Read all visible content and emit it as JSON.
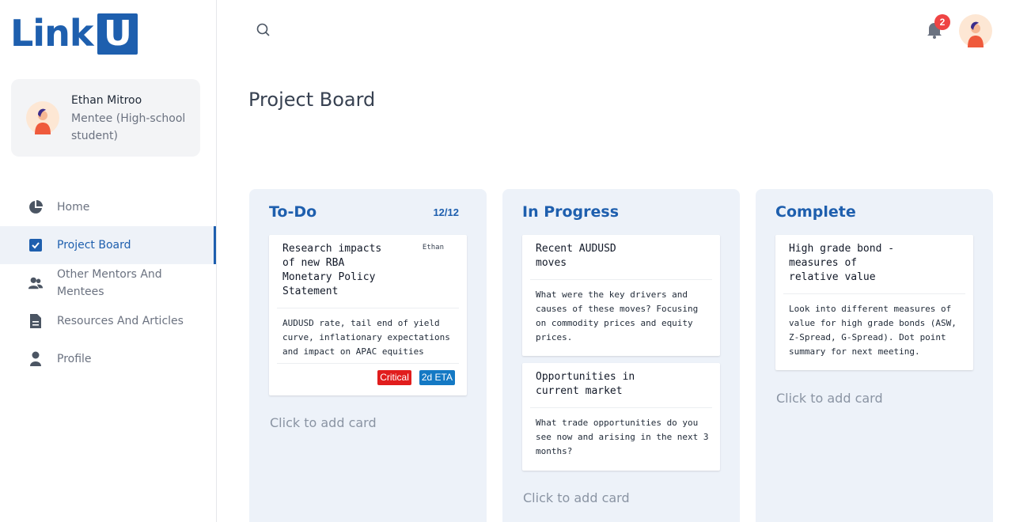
{
  "logo": {
    "text": "Link",
    "box_letter": "U",
    "color": "#1e5fae"
  },
  "user": {
    "name": "Ethan Mitroo",
    "role": "Mentee (High-school student)"
  },
  "nav": [
    {
      "label": "Home",
      "icon": "pie-chart-icon",
      "active": false
    },
    {
      "label": "Project Board",
      "icon": "checkbox-icon",
      "active": true
    },
    {
      "label": "Other Mentors And Mentees",
      "icon": "users-icon",
      "active": false
    },
    {
      "label": "Resources And Articles",
      "icon": "document-icon",
      "active": false
    },
    {
      "label": "Profile",
      "icon": "person-icon",
      "active": false
    }
  ],
  "topbar": {
    "notifications": "2",
    "search_icon": "search-icon",
    "bell_icon": "bell-icon"
  },
  "page": {
    "title": "Project Board"
  },
  "columns": [
    {
      "title": "To-Do",
      "count": "12/12",
      "cards": [
        {
          "title": "Research impacts\nof new RBA\nMonetary Policy\nStatement",
          "assignee": "Ethan",
          "description": "AUDUSD rate, tail end of yield curve, inflationary expectations and impact on APAC equities",
          "tags": [
            {
              "label": "Critical",
              "color": "#e11d1d"
            },
            {
              "label": "2d ETA",
              "color": "#1479c4"
            }
          ]
        }
      ],
      "add_label": "Click to add card"
    },
    {
      "title": "In Progress",
      "cards": [
        {
          "title": "Recent AUDUSD\nmoves",
          "description": "What were the key drivers and causes of these moves? Focusing on commodity prices and equity prices."
        },
        {
          "title": "Opportunities in\ncurrent market",
          "description": "What trade opportunities do you see now and arising in the next 3 months?"
        }
      ],
      "add_label": "Click to add card"
    },
    {
      "title": "Complete",
      "cards": [
        {
          "title": "High grade bond -\nmeasures of\nrelative value",
          "description": "Look into different measures of value for high grade bonds (ASW, Z-Spread, G-Spread). Dot point summary for next meeting."
        }
      ],
      "add_label": "Click to add card"
    }
  ]
}
